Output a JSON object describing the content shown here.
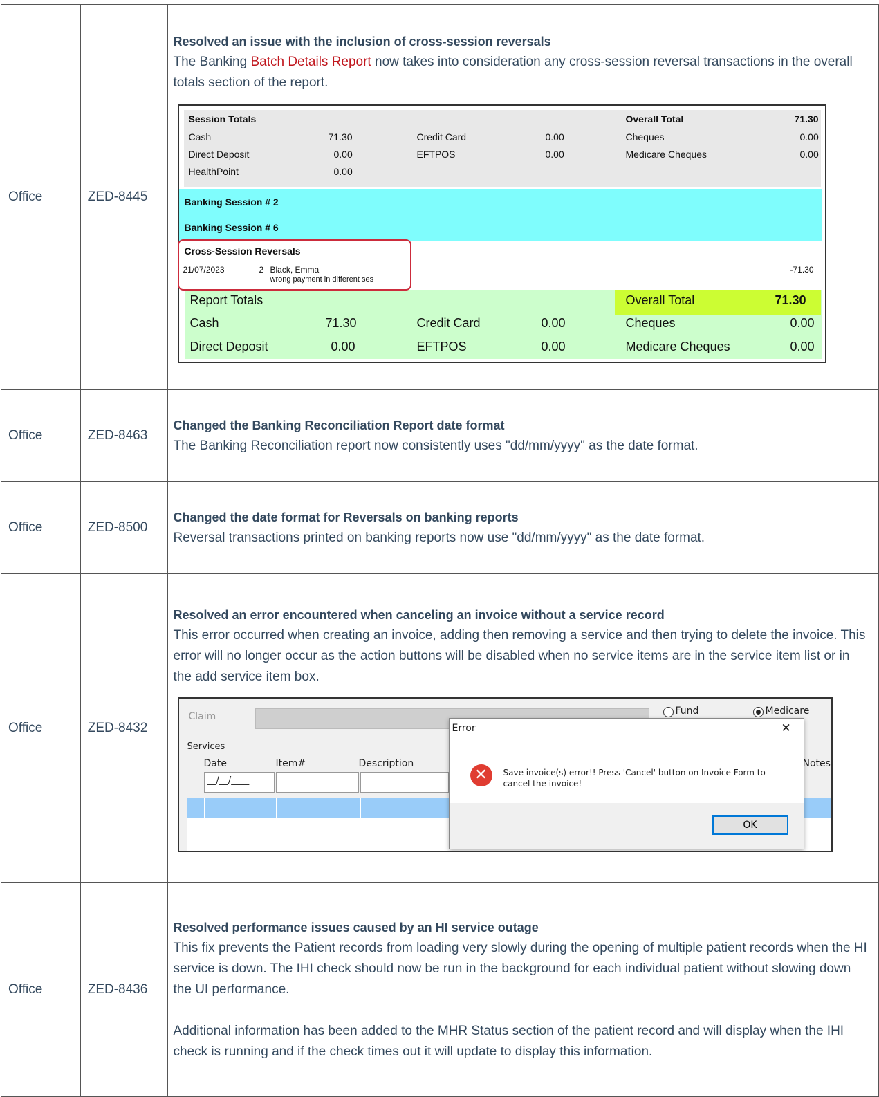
{
  "rows": [
    {
      "category": "Office",
      "ticket": "ZED-8445",
      "title": "Resolved an issue with the inclusion of cross-session reversals",
      "desc_before": "The Banking ",
      "desc_link": "Batch Details Report",
      "desc_after": " now takes into consideration any cross-session reversal transactions in the overall totals section of the report."
    },
    {
      "category": "Office",
      "ticket": "ZED-8463",
      "title": "Changed the Banking Reconciliation Report date format",
      "desc": "The Banking Reconciliation report now consistently uses \"dd/mm/yyyy\" as the date format."
    },
    {
      "category": "Office",
      "ticket": "ZED-8500",
      "title": "Changed the date format for Reversals on banking reports",
      "desc": "Reversal transactions printed on banking reports now use \"dd/mm/yyyy\" as the date format."
    },
    {
      "category": "Office",
      "ticket": "ZED-8432",
      "title": "Resolved an error encountered when canceling an invoice without a service record",
      "desc": "This error occurred when creating an invoice, adding then removing a service and then trying to delete the invoice. This error will no longer occur as the action buttons will be disabled when no service items are in the service item list or in the add service item box."
    },
    {
      "category": "Office",
      "ticket": "ZED-8436",
      "title": "Resolved performance issues caused by an HI service outage",
      "desc": "This fix prevents the Patient records from loading very slowly during the opening of multiple patient records when the HI service is down. The IHI check should now be run in the background for each individual patient without slowing down the UI performance.",
      "desc2": "Additional information has been added to the MHR Status section of the patient record and will display when the IHI check is running and if the check times out it will update to display this information."
    }
  ],
  "report": {
    "session_totals_label": "Session Totals",
    "overall_total_label": "Overall Total",
    "overall_total_value": "71.30",
    "cash_label": "Cash",
    "cash_value": "71.30",
    "credit_card_label": "Credit Card",
    "credit_card_value": "0.00",
    "cheques_label": "Cheques",
    "cheques_value": "0.00",
    "direct_deposit_label": "Direct Deposit",
    "direct_deposit_value": "0.00",
    "eftpos_label": "EFTPOS",
    "eftpos_value": "0.00",
    "medicare_cheques_label": "Medicare Cheques",
    "medicare_cheques_value": "0.00",
    "healthpoint_label": "HealthPoint",
    "healthpoint_value": "0.00",
    "session_2": "Banking Session #  2",
    "session_6": "Banking Session #  6",
    "reversals_label": "Cross-Session Reversals",
    "reversal_date": "21/07/2023",
    "reversal_session": "2",
    "reversal_name": "Black, Emma",
    "reversal_note": "wrong payment in different ses",
    "reversal_amount": "-71.30",
    "report_totals_label": "Report Totals",
    "rt_overall_label": "Overall Total",
    "rt_overall_value": "71.30",
    "rt_cash_value": "71.30",
    "rt_credit_card_value": "0.00",
    "rt_cheques_value": "0.00",
    "rt_direct_deposit_value": "0.00",
    "rt_eftpos_value": "0.00",
    "rt_medicare_cheques_value": "0.00"
  },
  "invoice": {
    "claim_label": "Claim",
    "fund_label": "Fund",
    "medicare_label": "Medicare",
    "services_label": "Services",
    "date_label": "Date",
    "item_label": "Item#",
    "description_label": "Description",
    "notes_label": "Notes",
    "date_placeholder": "__/__/____",
    "dialog_title": "Error",
    "dialog_close": "✕",
    "dialog_message": "Save invoice(s) error!! Press 'Cancel' button on Invoice Form to cancel the invoice!",
    "ok_label": "OK",
    "error_icon_glyph": "✕",
    "selected_row_color": "#99ccf9",
    "error_icon_color": "#e03c31"
  }
}
